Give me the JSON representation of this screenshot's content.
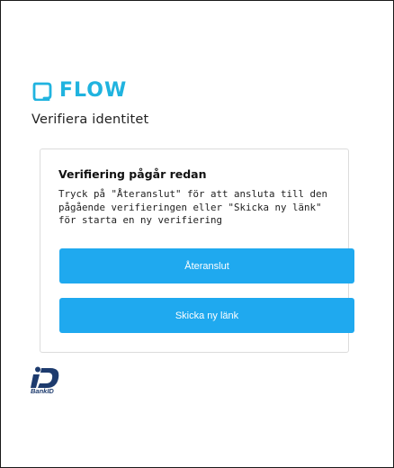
{
  "brand": {
    "name": "FLOW",
    "color": "#20b3df"
  },
  "page": {
    "title": "Verifiera identitet"
  },
  "card": {
    "heading": "Verifiering pågår redan",
    "body": "Tryck på \"Återanslut\" för att ansluta till den pågående verifieringen eller \"Skicka ny länk\" för starta en ny verifiering",
    "primary_button_color": "#1fa9ef"
  },
  "buttons": {
    "reconnect_label": "Återanslut",
    "new_link_label": "Skicka ny länk"
  },
  "footer": {
    "bankid_label": "BankID",
    "bankid_icon": "bankid-logo-icon"
  }
}
